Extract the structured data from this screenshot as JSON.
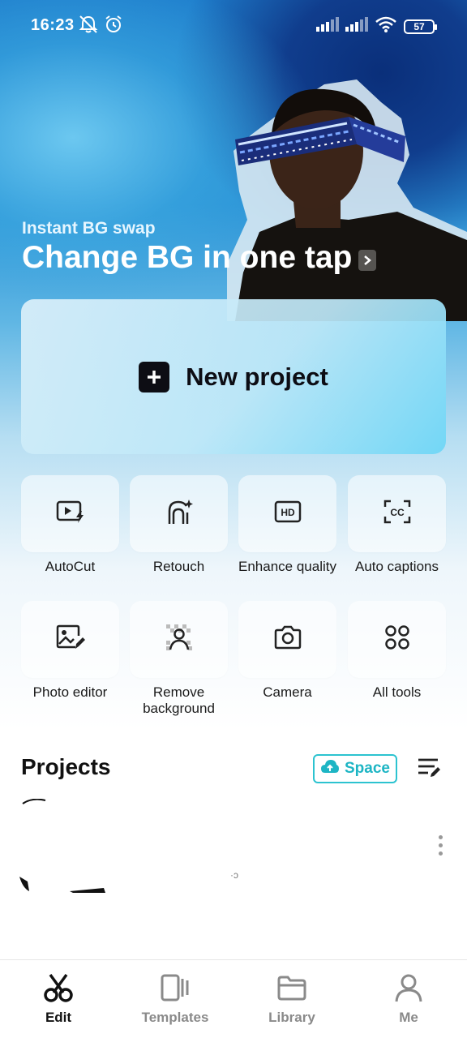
{
  "status_bar": {
    "time": "16:23",
    "battery": "57"
  },
  "banner": {
    "subtitle": "Instant BG swap",
    "title": "Change BG in one tap"
  },
  "new_project": {
    "label": "New project"
  },
  "tools": [
    {
      "label": "AutoCut",
      "icon": "autocut-icon"
    },
    {
      "label": "Retouch",
      "icon": "retouch-icon"
    },
    {
      "label": "Enhance quality",
      "icon": "hd-icon"
    },
    {
      "label": "Auto captions",
      "icon": "captions-icon"
    },
    {
      "label": "Photo editor",
      "icon": "photo-editor-icon"
    },
    {
      "label": "Remove background",
      "icon": "remove-bg-icon"
    },
    {
      "label": "Camera",
      "icon": "camera-icon"
    },
    {
      "label": "All tools",
      "icon": "grid-icon"
    }
  ],
  "projects": {
    "title": "Projects",
    "space_label": "Space"
  },
  "bottom_nav": [
    {
      "label": "Edit",
      "icon": "scissors-icon",
      "active": true
    },
    {
      "label": "Templates",
      "icon": "templates-icon",
      "active": false
    },
    {
      "label": "Library",
      "icon": "folder-icon",
      "active": false
    },
    {
      "label": "Me",
      "icon": "person-icon",
      "active": false
    }
  ],
  "colors": {
    "accent": "#1db5c4",
    "hero_top": "#1f7fcd",
    "dark": "#0d0d14"
  }
}
